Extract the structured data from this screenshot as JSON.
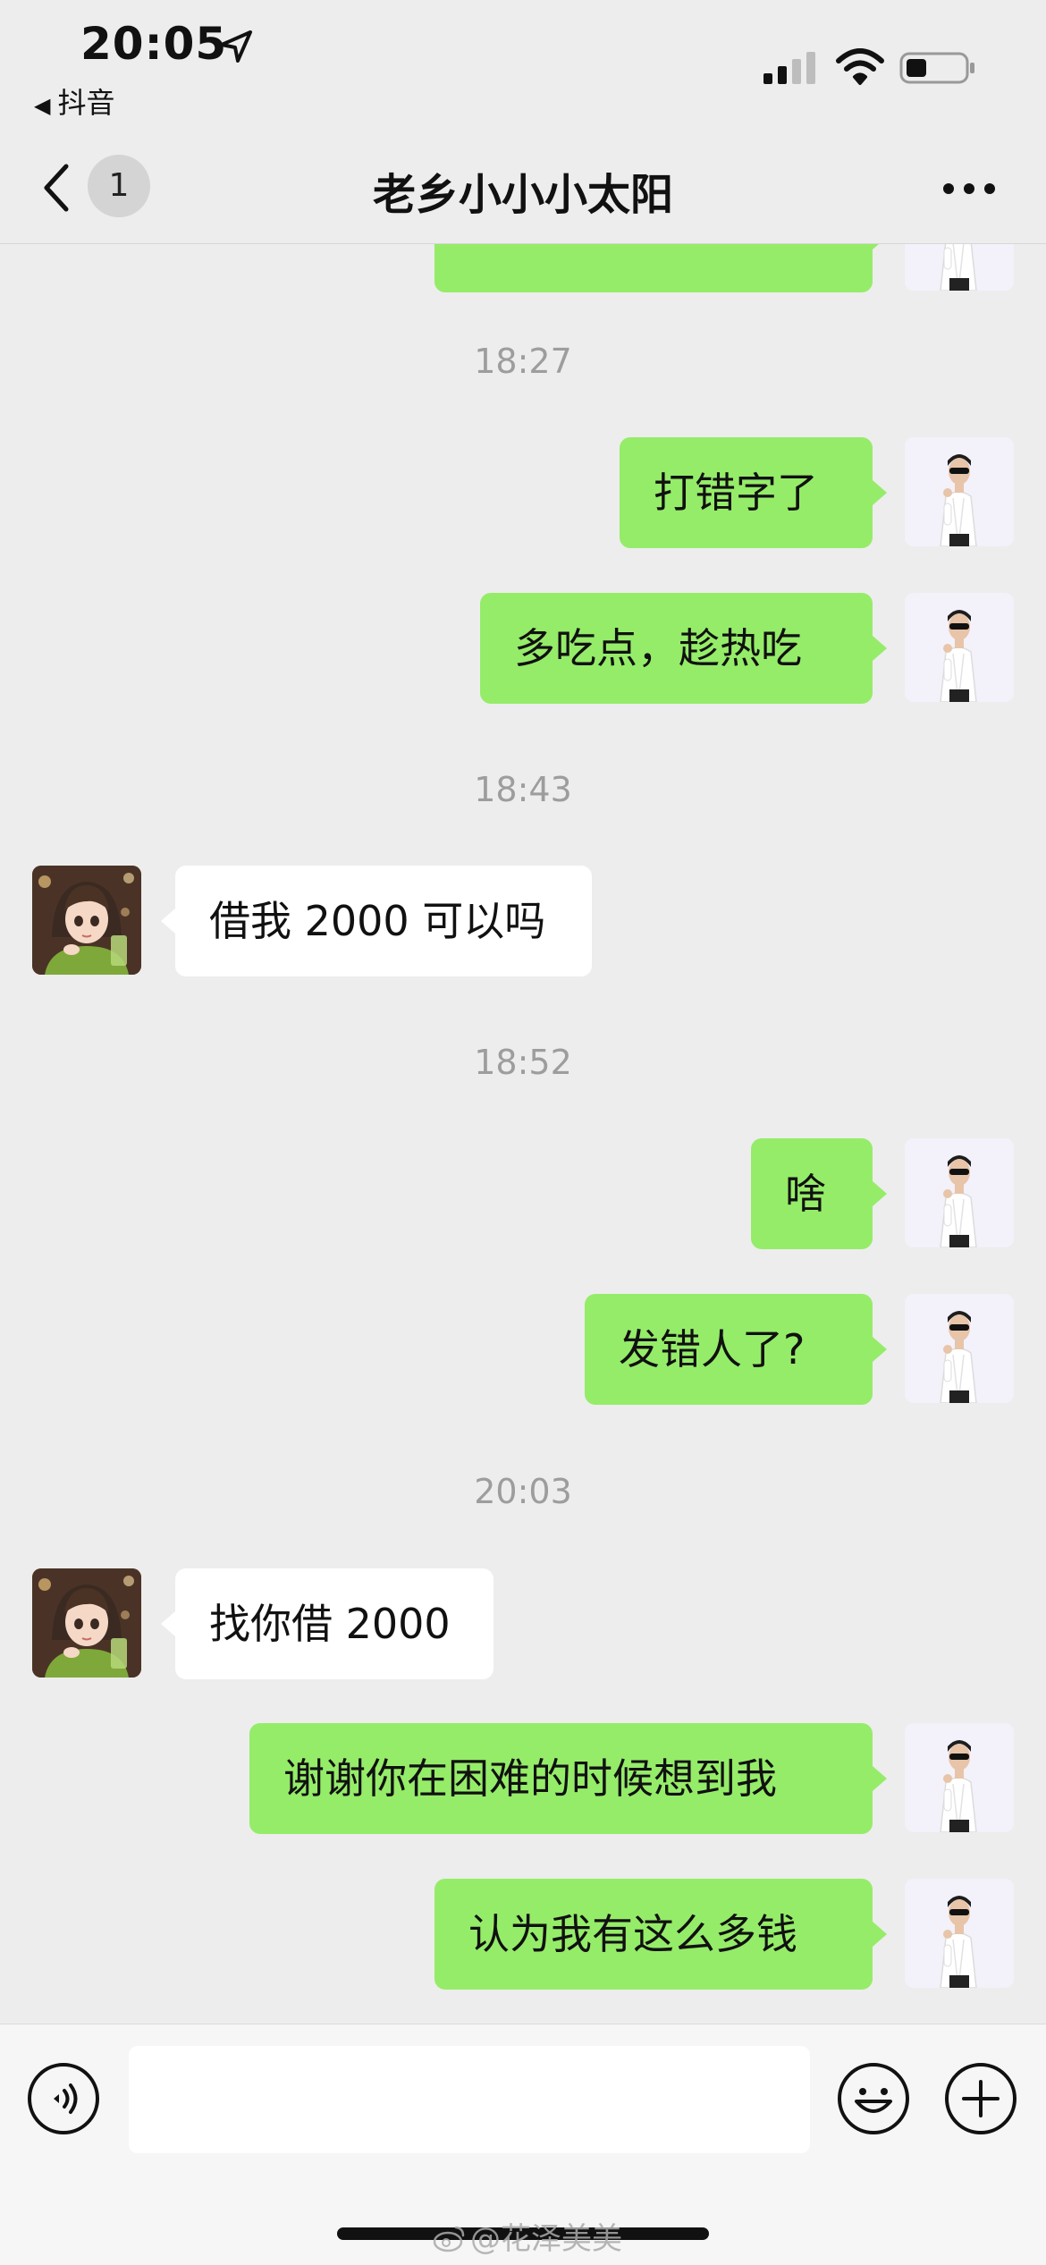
{
  "status_bar": {
    "time": "20:05",
    "back_app": "抖音",
    "back_glyph": "◀"
  },
  "header": {
    "title": "老乡小小小太阳",
    "unread_count": "1"
  },
  "messages": [
    {
      "type": "outgoing",
      "text": ""
    },
    {
      "type": "timestamp",
      "text": "18:27"
    },
    {
      "type": "outgoing",
      "text": "打错字了"
    },
    {
      "type": "outgoing",
      "text": "多吃点，趁热吃"
    },
    {
      "type": "timestamp",
      "text": "18:43"
    },
    {
      "type": "incoming",
      "text": "借我 2000 可以吗"
    },
    {
      "type": "timestamp",
      "text": "18:52"
    },
    {
      "type": "outgoing",
      "text": "啥"
    },
    {
      "type": "outgoing",
      "text": "发错人了?"
    },
    {
      "type": "timestamp",
      "text": "20:03"
    },
    {
      "type": "incoming",
      "text": "找你借 2000"
    },
    {
      "type": "outgoing",
      "text": "谢谢你在困难的时候想到我"
    },
    {
      "type": "outgoing",
      "text": "认为我有这么多钱"
    }
  ],
  "input_bar": {
    "value": "",
    "placeholder": ""
  },
  "watermark": "@花泽美美",
  "colors": {
    "background": "#ededed",
    "outgoing_bubble": "#95ec69",
    "incoming_bubble": "#ffffff",
    "timestamp_text": "#9d9d9d"
  },
  "icons": {
    "location": "location-arrow-icon",
    "signal": "cellular-signal-icon",
    "wifi": "wifi-icon",
    "battery": "battery-icon",
    "back": "chevron-left-icon",
    "more": "more-dots-icon",
    "voice": "voice-input-icon",
    "emoji": "emoji-icon",
    "plus": "plus-icon",
    "watermark": "weibo-logo-icon"
  }
}
